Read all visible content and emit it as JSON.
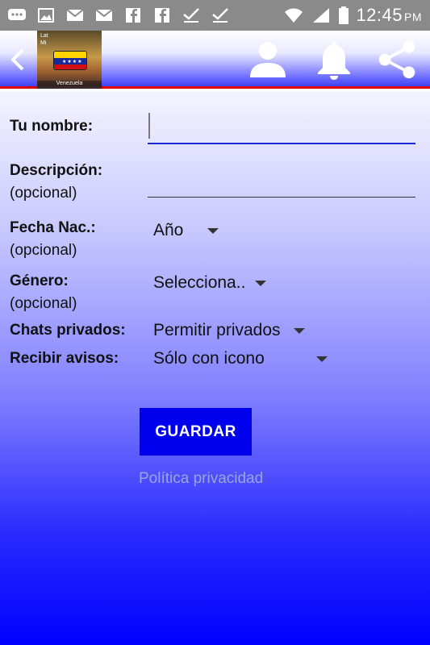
{
  "status_bar": {
    "time": "12:45",
    "ampm": "PM",
    "icons": [
      "chat-bubble-icon",
      "image-icon",
      "gmail-icon",
      "gmail-icon",
      "facebook-icon",
      "facebook-icon",
      "check-icon",
      "check-icon",
      "wifi-icon",
      "signal-icon",
      "battery-icon"
    ]
  },
  "app_bar": {
    "thumb_caption": "Venezuela",
    "thumb_mini": "Lat\nMi",
    "actions": [
      "person-icon",
      "bell-icon",
      "share-icon"
    ]
  },
  "form": {
    "name_label": "Tu nombre:",
    "name_value": "",
    "description_label": "Descripción:",
    "description_optional": "(opcional)",
    "birth_label": "Fecha Nac.:",
    "birth_optional": "(opcional)",
    "birth_value": "Año",
    "gender_label": "Género:",
    "gender_optional": "(opcional)",
    "gender_value": "Selecciona..",
    "private_chats_label": "Chats privados:",
    "private_chats_value": "Permitir privados",
    "notifications_label": "Recibir avisos:",
    "notifications_value": "Sólo con icono",
    "save_label": "GUARDAR",
    "privacy_label": "Política privacidad"
  },
  "colors": {
    "accent": "#0000ee",
    "name_underline": "#1a2ad0",
    "app_bar_border": "#e00000"
  }
}
